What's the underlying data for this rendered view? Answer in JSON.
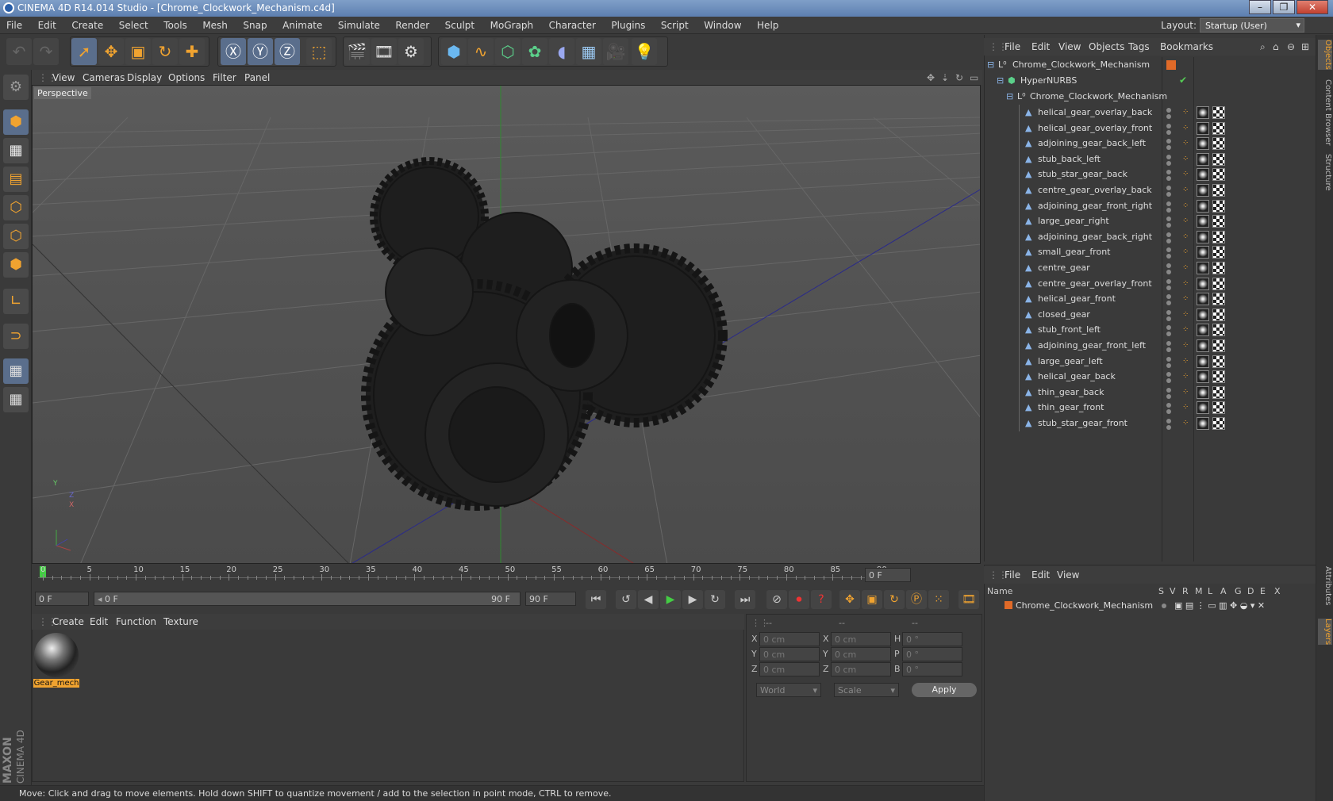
{
  "window": {
    "title": "CINEMA 4D R14.014 Studio - [Chrome_Clockwork_Mechanism.c4d]"
  },
  "menu": [
    "File",
    "Edit",
    "Create",
    "Select",
    "Tools",
    "Mesh",
    "Snap",
    "Animate",
    "Simulate",
    "Render",
    "Sculpt",
    "MoGraph",
    "Character",
    "Plugins",
    "Script",
    "Window",
    "Help"
  ],
  "layout": {
    "label": "Layout:",
    "value": "Startup (User)"
  },
  "viewport": {
    "menu": [
      "View",
      "Cameras",
      "Display",
      "Options",
      "Filter",
      "Panel"
    ],
    "label": "Perspective",
    "axis_labels": {
      "y": "Y",
      "z": "Z",
      "x": "X"
    }
  },
  "timeline": {
    "ticks": [
      "0",
      "5",
      "10",
      "15",
      "20",
      "25",
      "30",
      "35",
      "40",
      "45",
      "50",
      "55",
      "60",
      "65",
      "70",
      "75",
      "80",
      "85",
      "90"
    ],
    "current_frame": "0 F"
  },
  "transport": {
    "start_field": "0 F",
    "slider_start": "0 F",
    "slider_end": "90 F",
    "end_field": "90 F"
  },
  "materials": {
    "menu": [
      "Create",
      "Edit",
      "Function",
      "Texture"
    ],
    "items": [
      {
        "name": "Gear_mech"
      }
    ]
  },
  "coordinates": {
    "header": [
      "--",
      "--",
      "--"
    ],
    "rows": [
      {
        "a": "X",
        "a_val": "0 cm",
        "b": "X",
        "b_val": "0 cm",
        "c": "H",
        "c_val": "0 °"
      },
      {
        "a": "Y",
        "a_val": "0 cm",
        "b": "Y",
        "b_val": "0 cm",
        "c": "P",
        "c_val": "0 °"
      },
      {
        "a": "Z",
        "a_val": "0 cm",
        "b": "Z",
        "b_val": "0 cm",
        "c": "B",
        "c_val": "0 °"
      }
    ],
    "mode": "World",
    "scale": "Scale",
    "apply": "Apply"
  },
  "status": "Move: Click and drag to move elements. Hold down SHIFT to quantize movement / add to the selection in point mode, CTRL to remove.",
  "objects": {
    "menu": [
      "File",
      "Edit",
      "View",
      "Objects",
      "Tags",
      "Bookmarks"
    ],
    "root": "Chrome_Clockwork_Mechanism",
    "hypernurbs": "HyperNURBS",
    "group": "Chrome_Clockwork_Mechanism",
    "children": [
      "helical_gear_overlay_back",
      "helical_gear_overlay_front",
      "adjoining_gear_back_left",
      "stub_back_left",
      "stub_star_gear_back",
      "centre_gear_overlay_back",
      "adjoining_gear_front_right",
      "large_gear_right",
      "adjoining_gear_back_right",
      "small_gear_front",
      "centre_gear",
      "centre_gear_overlay_front",
      "helical_gear_front",
      "closed_gear",
      "stub_front_left",
      "adjoining_gear_front_left",
      "large_gear_left",
      "helical_gear_back",
      "thin_gear_back",
      "thin_gear_front",
      "stub_star_gear_front"
    ]
  },
  "layers": {
    "menu": [
      "File",
      "Edit",
      "View"
    ],
    "columns": [
      "Name",
      "S",
      "V",
      "R",
      "M",
      "L",
      "A",
      "G",
      "D",
      "E",
      "X"
    ],
    "row": "Chrome_Clockwork_Mechanism"
  },
  "side_tabs": [
    "Objects",
    "Content Browser",
    "Structure",
    "Attributes",
    "Layers"
  ],
  "brand": {
    "maxon": "MAXON",
    "product": "CINEMA 4D"
  },
  "colors": {
    "accent": "#f0a330",
    "selection": "#5a6e8c",
    "title_bar": "#6f8fbf"
  }
}
